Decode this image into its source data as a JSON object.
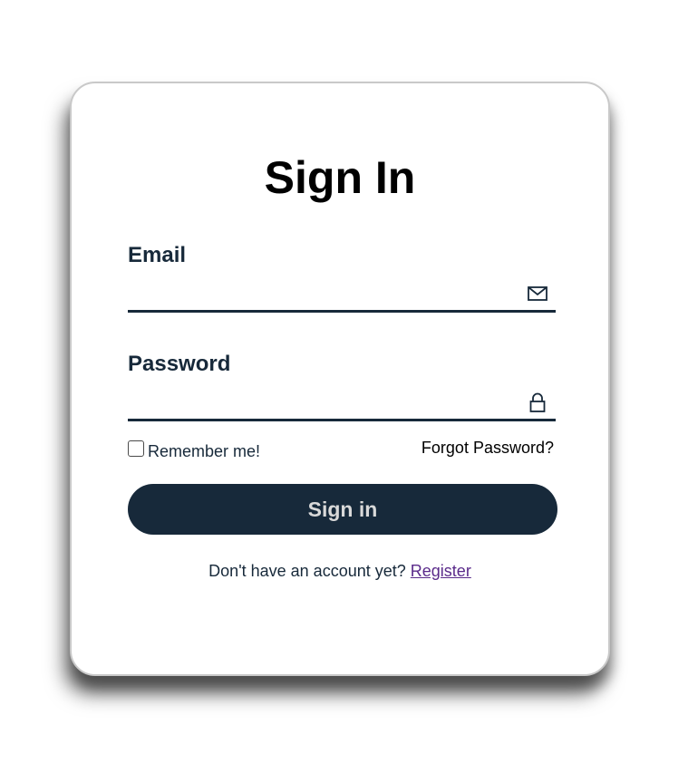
{
  "form": {
    "title": "Sign In",
    "email_label": "Email",
    "email_value": "",
    "email_icon": "mail-icon",
    "password_label": "Password",
    "password_value": "",
    "password_icon": "lock-icon",
    "remember_label": "Remember me!",
    "remember_checked": false,
    "forgot_label": "Forgot Password?",
    "submit_label": "Sign in",
    "register_prompt": "Don't have an account yet?",
    "register_link": "Register"
  },
  "colors": {
    "primary": "#17293a",
    "link": "#5a2a8a",
    "button_text": "#d9d9d9"
  }
}
